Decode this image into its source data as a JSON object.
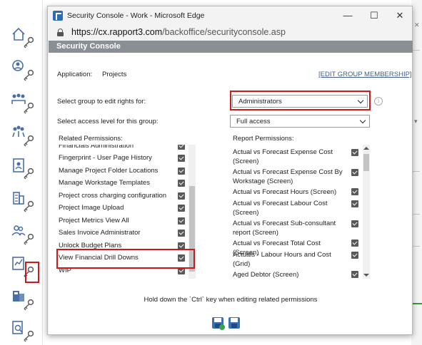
{
  "window": {
    "title": "Security Console - Work - Microsoft Edge",
    "minimize": "—",
    "maximize": "☐",
    "close": "✕"
  },
  "address": {
    "host": "https://cx.rapport3.com",
    "path": "/backoffice/securityconsole.asp"
  },
  "console": {
    "header": "Security Console",
    "application_label": "Application:",
    "application_value": "Projects",
    "edit_group_link": "[EDIT GROUP MEMBERSHIP]",
    "group_label": "Select group to edit rights for:",
    "group_value": "Administrators",
    "access_label": "Select access level for this group:",
    "access_value": "Full access",
    "related_heading": "Related Permissions:",
    "report_heading": "Report Permissions:",
    "hint": "Hold down the `Ctrl` key when editing related permissions"
  },
  "related_permissions": [
    {
      "label": "Financials Administration",
      "checked": true
    },
    {
      "label": "Fingerprint - User Page History",
      "checked": true
    },
    {
      "label": "Manage Project Folder Locations",
      "checked": true
    },
    {
      "label": "Manage Workstage Templates",
      "checked": true
    },
    {
      "label": "Project cross charging configuration",
      "checked": true
    },
    {
      "label": "Project Image Upload",
      "checked": true
    },
    {
      "label": "Project Metrics View All",
      "checked": true
    },
    {
      "label": "Sales Invoice Administrator",
      "checked": true
    },
    {
      "label": "Unlock Budget Plans",
      "checked": true
    },
    {
      "label": "View Financial Drill Downs",
      "checked": true,
      "highlighted": true
    },
    {
      "label": "WIP",
      "checked": true
    }
  ],
  "report_permissions": [
    {
      "label": "Actual vs Forecast Expense Cost (Screen)",
      "checked": true
    },
    {
      "label": "Actual vs Forecast Expense Cost By Workstage (Screen)",
      "checked": true
    },
    {
      "label": "Actual vs Forecast Hours (Screen)",
      "checked": true
    },
    {
      "label": "Actual vs Forecast Labour Cost (Screen)",
      "checked": true
    },
    {
      "label": "Actual vs Forecast Sub-consultant report (Screen)",
      "checked": true
    },
    {
      "label": "Actual vs Forecast Total Cost (Screen)",
      "checked": true
    },
    {
      "label": "Actuals - Labour Hours and Cost (Grid)",
      "checked": true
    },
    {
      "label": "Aged Debtor (Screen)",
      "checked": true
    }
  ],
  "sidebar": [
    {
      "icon": "home-icon"
    },
    {
      "icon": "user-search-icon"
    },
    {
      "icon": "group-icon"
    },
    {
      "icon": "team-icon"
    },
    {
      "icon": "contact-card-icon"
    },
    {
      "icon": "building-icon"
    },
    {
      "icon": "people-icon"
    },
    {
      "icon": "chart-document-icon",
      "highlighted": true
    },
    {
      "icon": "calculator-icon"
    },
    {
      "icon": "search-document-icon"
    }
  ],
  "colors": {
    "highlight": "#d11818",
    "header_bg": "#8a8f95",
    "link": "#3f5f8a",
    "checkbox": "#595959"
  }
}
